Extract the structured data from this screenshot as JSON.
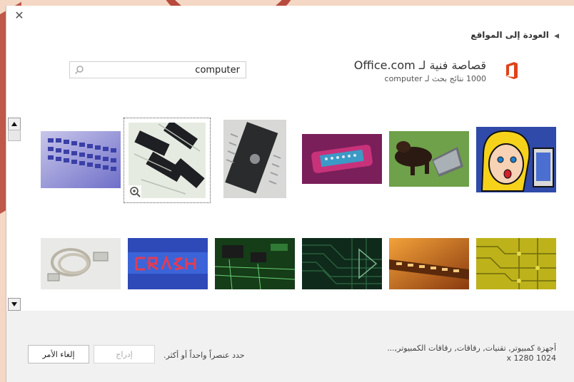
{
  "header": {
    "close_symbol": "✕",
    "back_label": "العودة إلى المواقع",
    "provider_title": "قصاصة فنية لـ Office.com",
    "provider_subtitle": "1000 نتائج بحث لـ computer"
  },
  "search": {
    "value": "computer",
    "icon": "search-icon"
  },
  "colors": {
    "office_orange": "#e0421b",
    "footer_bg": "#f1f1f1",
    "accent_frame": "#b84a3e"
  },
  "results": {
    "row1": [
      "keyboard",
      "chips",
      "eprom-chip",
      "cable-connector",
      "dog-laptop",
      "cartoon-woman-computer"
    ],
    "row2": [
      "coiled-cable",
      "crash-text",
      "circuit-board",
      "green-circuit",
      "orange-chip",
      "yellow-circuit"
    ],
    "selected_index": 1
  },
  "footer": {
    "cancel_label": "إلغاء الأمر",
    "insert_label": "إدراج",
    "hint": "حدد عنصراً واحداً أو أكثر.",
    "desc_line1": "أجهزة كمبيوتر, تقنيات, رقاقات, رقاقات الكمبيوتر,...",
    "desc_line2": "1024 x 1280"
  }
}
